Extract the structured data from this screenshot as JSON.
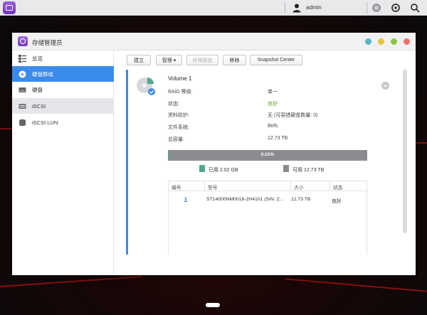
{
  "topbar": {
    "user_name": "admin"
  },
  "window": {
    "title": "存储管理员",
    "dots": [
      "#5bb6c4",
      "#e8c63a",
      "#8cc63f",
      "#ef6f6a"
    ]
  },
  "sidebar": {
    "items": [
      {
        "label": "总览",
        "icon": "overview-icon"
      },
      {
        "label": "硬盘群组",
        "icon": "disk-group-icon"
      },
      {
        "label": "硬盘",
        "icon": "disk-icon"
      },
      {
        "label": "iSCSI",
        "icon": "iscsi-icon"
      },
      {
        "label": "iSCSI LUN",
        "icon": "iscsi-lun-icon"
      }
    ]
  },
  "toolbar": {
    "create": "建立",
    "manage": "管理 ▾",
    "repair": "修理硬盘",
    "remove": "移除",
    "snapshot": "Snapshot Center"
  },
  "volume": {
    "title": "Volume 1",
    "props": [
      {
        "label": "RAID 等级:",
        "value": "单一"
      },
      {
        "label": "状态:",
        "value": "良好"
      },
      {
        "label": "资料防护:",
        "value": "无 (可容错硬盘数量: 0)"
      },
      {
        "label": "文件系统:",
        "value": "Btrfs"
      },
      {
        "label": "总容量:",
        "value": "12.73 TB"
      }
    ],
    "usage_percent_label": "0.01%",
    "usage_fraction": 0.0001,
    "used_label": "已用 2.02 GB",
    "free_label": "可用 12.73 TB",
    "used_color": "#4fa88c",
    "free_color": "#8c8c90",
    "status_good_color": "#5aa02c"
  },
  "disk_table": {
    "headers": [
      "编号",
      "型号",
      "大小",
      "状态"
    ],
    "rows": [
      {
        "num": "1",
        "model": "ST14000NM0018-2H4101 (S/N: Z...",
        "size": "12.73 TB",
        "status": "良好"
      }
    ]
  }
}
